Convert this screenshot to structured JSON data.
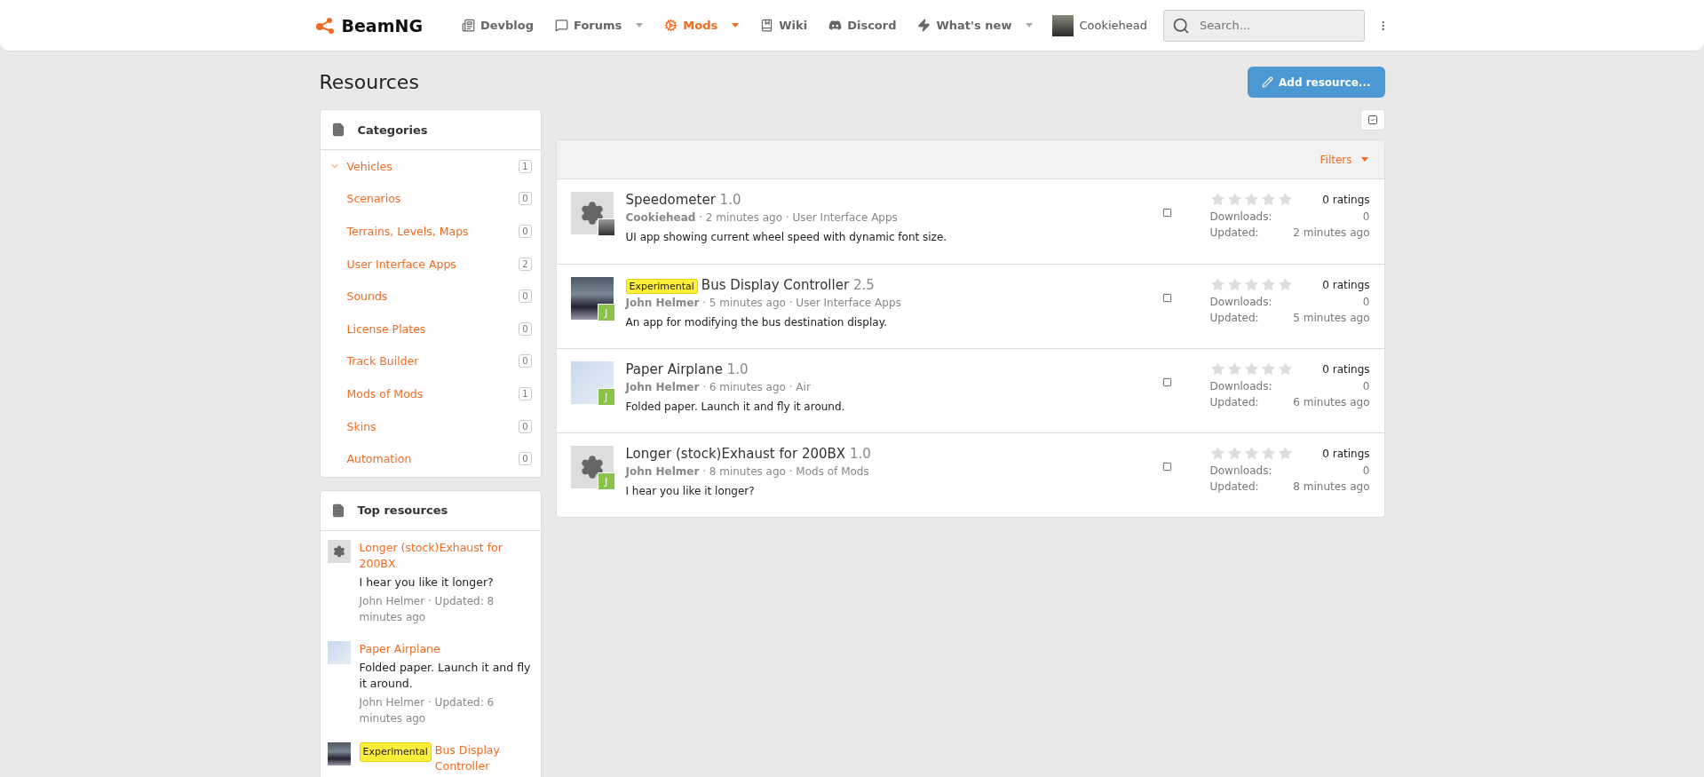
{
  "header": {
    "logo": "BeamNG",
    "nav": [
      {
        "kind": "devblog",
        "label": "Devblog",
        "selected": false,
        "dropdown": false
      },
      {
        "kind": "forums",
        "label": "Forums",
        "selected": false,
        "dropdown": true
      },
      {
        "kind": "mods",
        "label": "Mods",
        "selected": true,
        "dropdown": true
      },
      {
        "kind": "wiki",
        "label": "Wiki",
        "selected": false,
        "dropdown": false
      },
      {
        "kind": "discord",
        "label": "Discord",
        "selected": false,
        "dropdown": false
      },
      {
        "kind": "whatsnew",
        "label": "What's new",
        "selected": false,
        "dropdown": true
      }
    ],
    "user": "Cookiehead",
    "search": {
      "placeholder": "Search..."
    }
  },
  "page": {
    "title": "Resources",
    "add_button": "Add resource..."
  },
  "categories": {
    "title": "Categories",
    "items": [
      {
        "label": "Vehicles",
        "count": "1",
        "expanded": true
      },
      {
        "label": "Scenarios",
        "count": "0",
        "expanded": false
      },
      {
        "label": "Terrains, Levels, Maps",
        "count": "0",
        "expanded": false
      },
      {
        "label": "User Interface Apps",
        "count": "2",
        "expanded": false
      },
      {
        "label": "Sounds",
        "count": "0",
        "expanded": false
      },
      {
        "label": "License Plates",
        "count": "0",
        "expanded": false
      },
      {
        "label": "Track Builder",
        "count": "0",
        "expanded": false
      },
      {
        "label": "Mods of Mods",
        "count": "1",
        "expanded": false
      },
      {
        "label": "Skins",
        "count": "0",
        "expanded": false
      },
      {
        "label": "Automation",
        "count": "0",
        "expanded": false
      }
    ]
  },
  "top_resources": {
    "title": "Top resources",
    "items": [
      {
        "kind": "gear",
        "title": "Longer (stock)Exhaust for 200BX",
        "description": "I hear you like it longer?",
        "meta": "John Helmer · Updated: 8 minutes ago"
      },
      {
        "kind": "airplane",
        "title": "Paper Airplane",
        "description": "Folded paper. Launch it and fly it around.",
        "meta": "John Helmer · Updated: 6 minutes ago"
      },
      {
        "kind": "bus",
        "prefix": "Experimental",
        "title": "Bus Display Controller"
      }
    ]
  },
  "resources": {
    "filters": "Filters",
    "items": [
      {
        "kind": "gear",
        "avatar": {
          "kind": "photo"
        },
        "title": "Speedometer",
        "version": "1.0",
        "meta": "**Cookiehead** · 2 minutes ago · User Interface Apps",
        "description": "UI app showing current wheel speed with dynamic font size.",
        "checked": false,
        "stars": 0,
        "ratings": "0 ratings",
        "downloads_label": "Downloads:",
        "downloads": "0",
        "updated_label": "Updated:",
        "updated": "2 minutes ago"
      },
      {
        "kind": "bus",
        "avatar": {
          "kind": "letter",
          "letter": "J"
        },
        "prefix": "Experimental",
        "title": "Bus Display Controller",
        "version": "2.5",
        "meta": "**John Helmer** · 5 minutes ago · User Interface Apps",
        "description": "An app for modifying the bus destination display.",
        "checked": false,
        "stars": 0,
        "ratings": "0 ratings",
        "downloads_label": "Downloads:",
        "downloads": "0",
        "updated_label": "Updated:",
        "updated": "5 minutes ago"
      },
      {
        "kind": "airplane",
        "avatar": {
          "kind": "letter",
          "letter": "J"
        },
        "title": "Paper Airplane",
        "version": "1.0",
        "meta": "**John Helmer** · 6 minutes ago · Air",
        "description": "Folded paper. Launch it and fly it around.",
        "checked": false,
        "stars": 0,
        "ratings": "0 ratings",
        "downloads_label": "Downloads:",
        "downloads": "0",
        "updated_label": "Updated:",
        "updated": "6 minutes ago"
      },
      {
        "kind": "gear",
        "avatar": {
          "kind": "letter",
          "letter": "J"
        },
        "title": "Longer (stock)Exhaust for 200BX",
        "version": "1.0",
        "meta": "**John Helmer** · 8 minutes ago · Mods of Mods",
        "description": "I hear you like it longer?",
        "checked": false,
        "stars": 0,
        "ratings": "0 ratings",
        "downloads_label": "Downloads:",
        "downloads": "0",
        "updated_label": "Updated:",
        "updated": "8 minutes ago"
      }
    ]
  }
}
